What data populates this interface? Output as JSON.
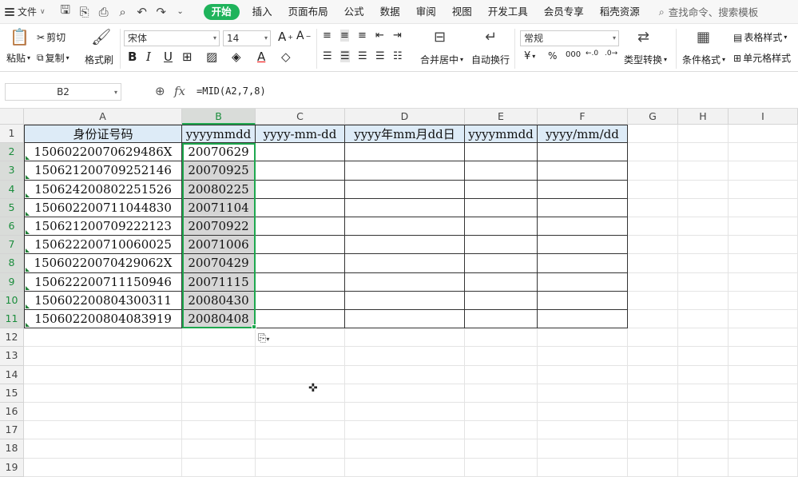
{
  "menu": {
    "file_label": "文件",
    "tabs": [
      "开始",
      "插入",
      "页面布局",
      "公式",
      "数据",
      "审阅",
      "视图",
      "开发工具",
      "会员专享",
      "稻壳资源"
    ],
    "active_tab": "开始",
    "search_placeholder": "查找命令、搜索模板"
  },
  "ribbon": {
    "cut": "剪切",
    "paste": "粘贴",
    "copy": "复制",
    "format_painter": "格式刷",
    "font_name": "宋体",
    "font_size": "14",
    "merge_center": "合并居中",
    "wrap_text": "自动换行",
    "number_format": "常规",
    "type_convert": "类型转换",
    "conditional_format": "条件格式",
    "table_style": "表格样式",
    "cell_style": "单元格样式",
    "currency_symbol": "¥",
    "percent_symbol": "%",
    "thousands_symbol": "000"
  },
  "formula_bar": {
    "name_box": "B2",
    "fx": "fx",
    "formula": "=MID(A2,7,8)"
  },
  "grid": {
    "columns": [
      "A",
      "B",
      "C",
      "D",
      "E",
      "F",
      "G",
      "H",
      "I"
    ],
    "rows": [
      "1",
      "2",
      "3",
      "4",
      "5",
      "6",
      "7",
      "8",
      "9",
      "10",
      "11",
      "12",
      "13",
      "14",
      "15",
      "16",
      "17",
      "18",
      "19"
    ],
    "headers": [
      "身份证号码",
      "yyyymmdd",
      "yyyy-mm-dd",
      "yyyy年mm月dd日",
      "yyyymmdd",
      "yyyy/mm/dd"
    ],
    "id_numbers": [
      "15060220070629486X",
      "150621200709252146",
      "150624200802251526",
      "150602200711044830",
      "150621200709222123",
      "150622200710060025",
      "15060220070429062X",
      "150622200711150946",
      "150602200804300311",
      "150602200804083919"
    ],
    "dates": [
      "20070629",
      "20070925",
      "20080225",
      "20071104",
      "20070922",
      "20071006",
      "20070429",
      "20071115",
      "20080430",
      "20080408"
    ]
  },
  "colors": {
    "accent": "#1fb35b",
    "header_fill": "#ddebf7",
    "selection_border": "#1fa84f"
  }
}
